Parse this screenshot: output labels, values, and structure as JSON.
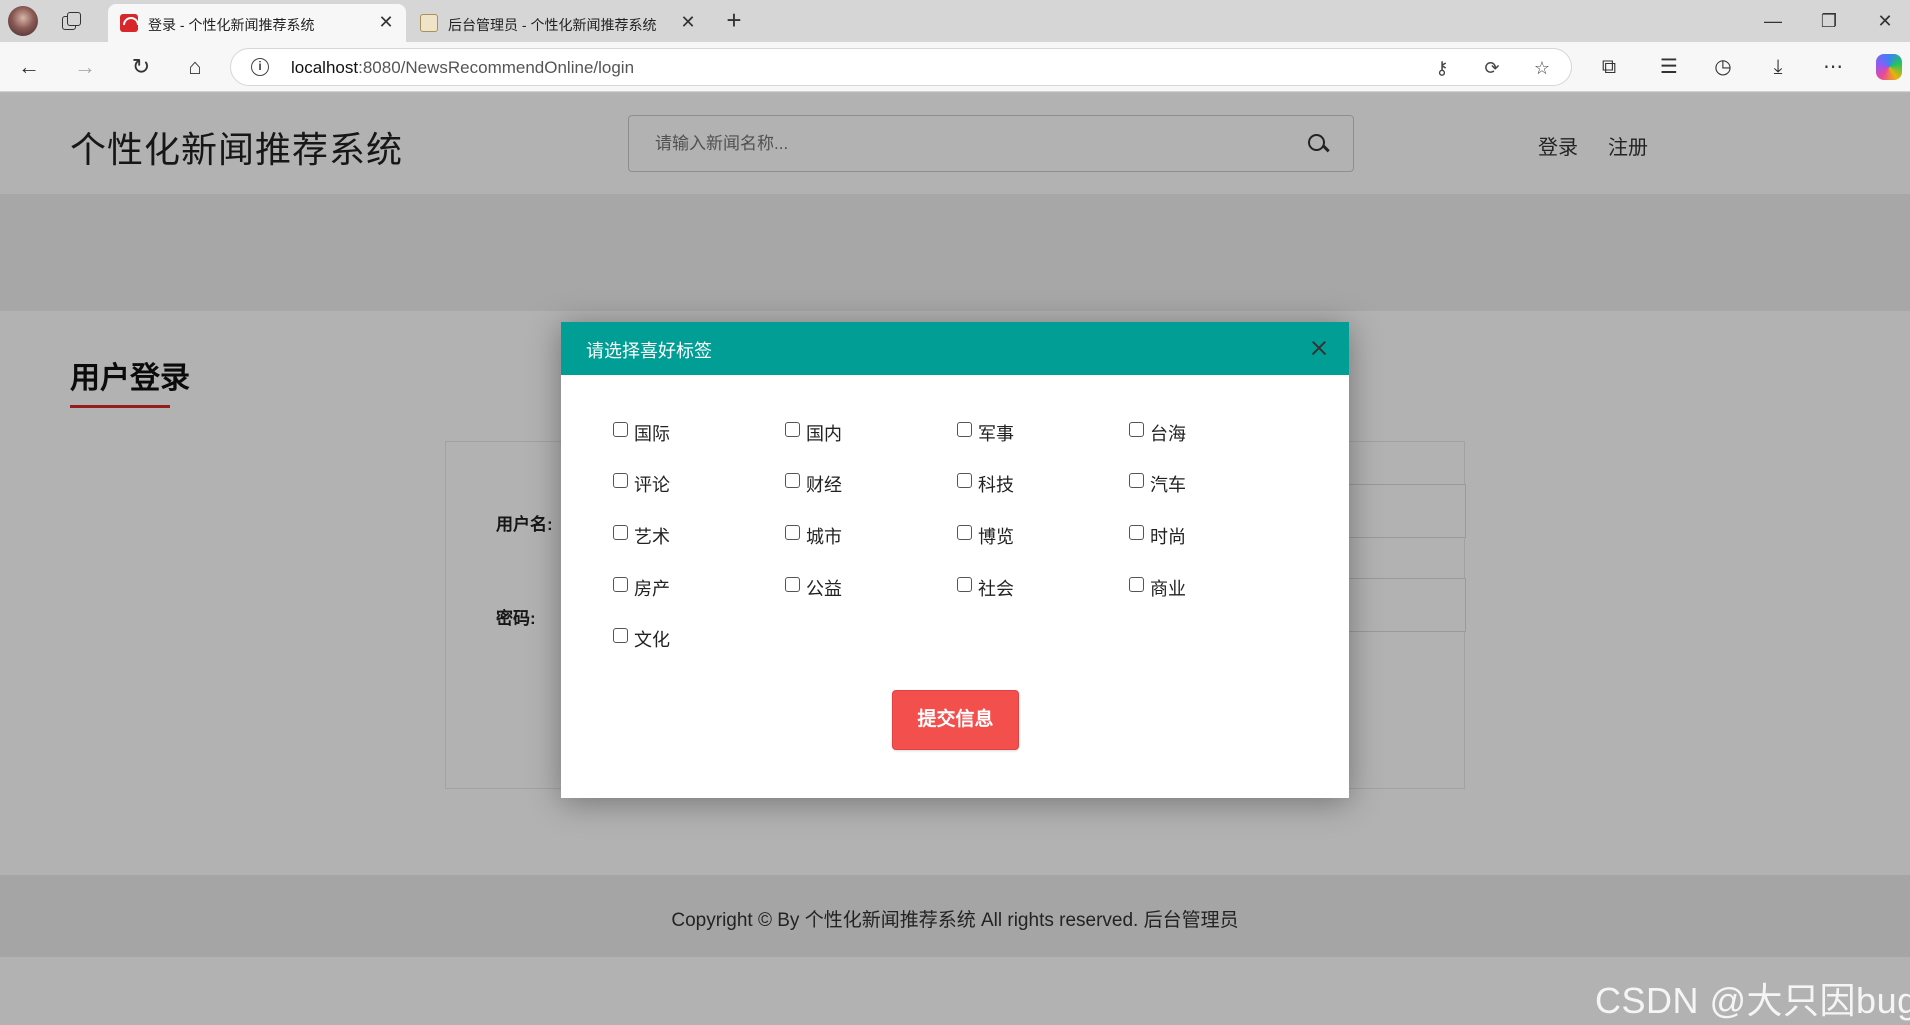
{
  "browser": {
    "tabs": [
      {
        "title": "登录 - 个性化新闻推荐系统",
        "active": true
      },
      {
        "title": "后台管理员 - 个性化新闻推荐系统",
        "active": false
      }
    ],
    "url_host": "localhost",
    "url_rest": ":8080/NewsRecommendOnline/login",
    "tab_close_glyph": "✕",
    "new_tab_glyph": "+",
    "window_controls": {
      "minimize": "—",
      "restore": "❐",
      "close": "✕"
    },
    "nav": {
      "back": "←",
      "forward": "→",
      "reload": "↻",
      "home": "⌂"
    }
  },
  "site": {
    "logo": "个性化新闻推荐系统",
    "search_placeholder": "请输入新闻名称...",
    "nav_links": [
      "登录",
      "注册"
    ]
  },
  "login": {
    "title": "用户登录",
    "username_label": "用户名:",
    "password_label": "密码:"
  },
  "modal": {
    "title": "请选择喜好标签",
    "tags": [
      "国际",
      "国内",
      "军事",
      "台海",
      "评论",
      "财经",
      "科技",
      "汽车",
      "艺术",
      "城市",
      "博览",
      "时尚",
      "房产",
      "公益",
      "社会",
      "商业",
      "文化"
    ],
    "submit_label": "提交信息"
  },
  "footer": {
    "text": "Copyright © By 个性化新闻推荐系统 All rights reserved. 后台管理员"
  },
  "watermark": "CSDN @大只因bug",
  "colors": {
    "modal_header": "#009e94",
    "submit_button": "#f24f4d",
    "title_underline": "#d42b2b"
  }
}
